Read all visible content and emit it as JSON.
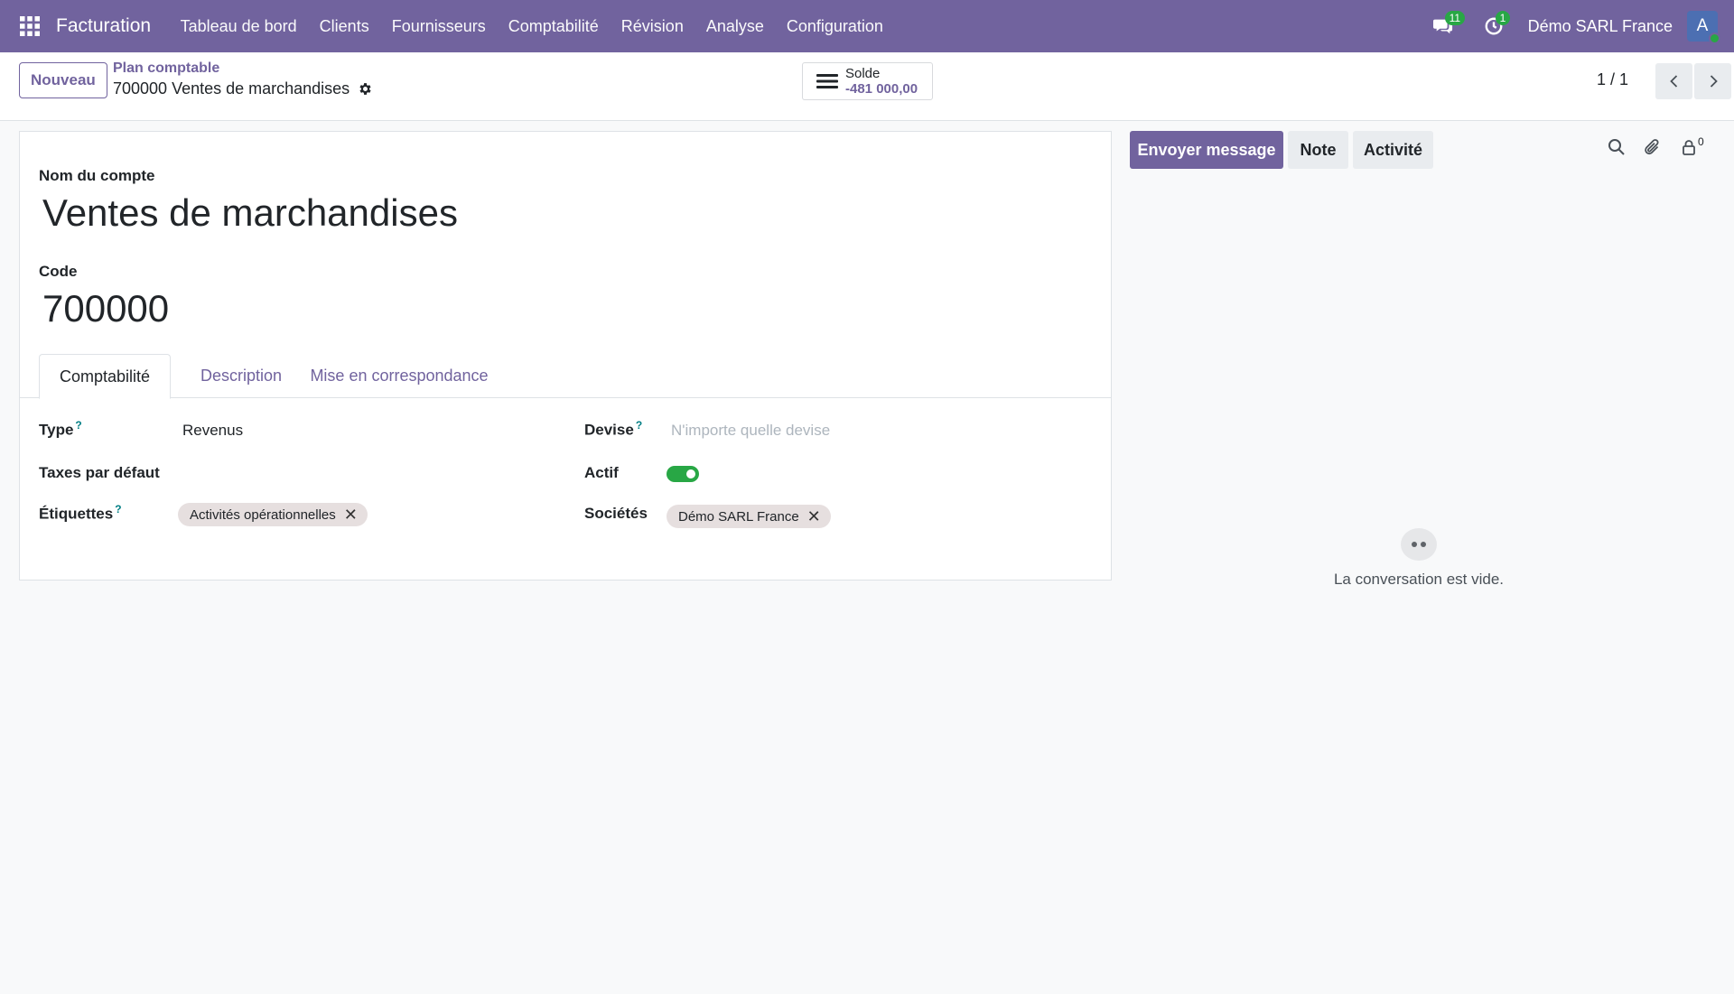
{
  "navbar": {
    "app_name": "Facturation",
    "menu": [
      "Tableau de bord",
      "Clients",
      "Fournisseurs",
      "Comptabilité",
      "Révision",
      "Analyse",
      "Configuration"
    ],
    "messages_count": "11",
    "activities_count": "1",
    "company": "Démo SARL France",
    "avatar_letter": "A"
  },
  "control_panel": {
    "new_button": "Nouveau",
    "breadcrumb_parent": "Plan comptable",
    "breadcrumb_current": "700000 Ventes de marchandises",
    "smart_button": {
      "label": "Solde",
      "value": "-481 000,00"
    },
    "pager": "1 / 1"
  },
  "form": {
    "name_label": "Nom du compte",
    "name_value": "Ventes de marchandises",
    "code_label": "Code",
    "code_value": "700000",
    "tabs": [
      {
        "label": "Comptabilité",
        "active": true
      },
      {
        "label": "Description",
        "active": false
      },
      {
        "label": "Mise en correspondance",
        "active": false
      }
    ],
    "fields": {
      "type_label": "Type",
      "type_value": "Revenus",
      "taxes_label": "Taxes par défaut",
      "tags_label": "Étiquettes",
      "tag_value": "Activités opérationnelles",
      "currency_label": "Devise",
      "currency_placeholder": "N'importe quelle devise",
      "active_label": "Actif",
      "active_value": true,
      "companies_label": "Sociétés",
      "company_tag": "Démo SARL France",
      "help_mark": "?"
    }
  },
  "chatter": {
    "send_message": "Envoyer message",
    "note": "Note",
    "activity": "Activité",
    "followers_count": "0",
    "empty_text": "La conversation est vide."
  },
  "colors": {
    "brand": "#71639e",
    "success": "#28a745",
    "tag_bg": "#e6dfdf"
  }
}
